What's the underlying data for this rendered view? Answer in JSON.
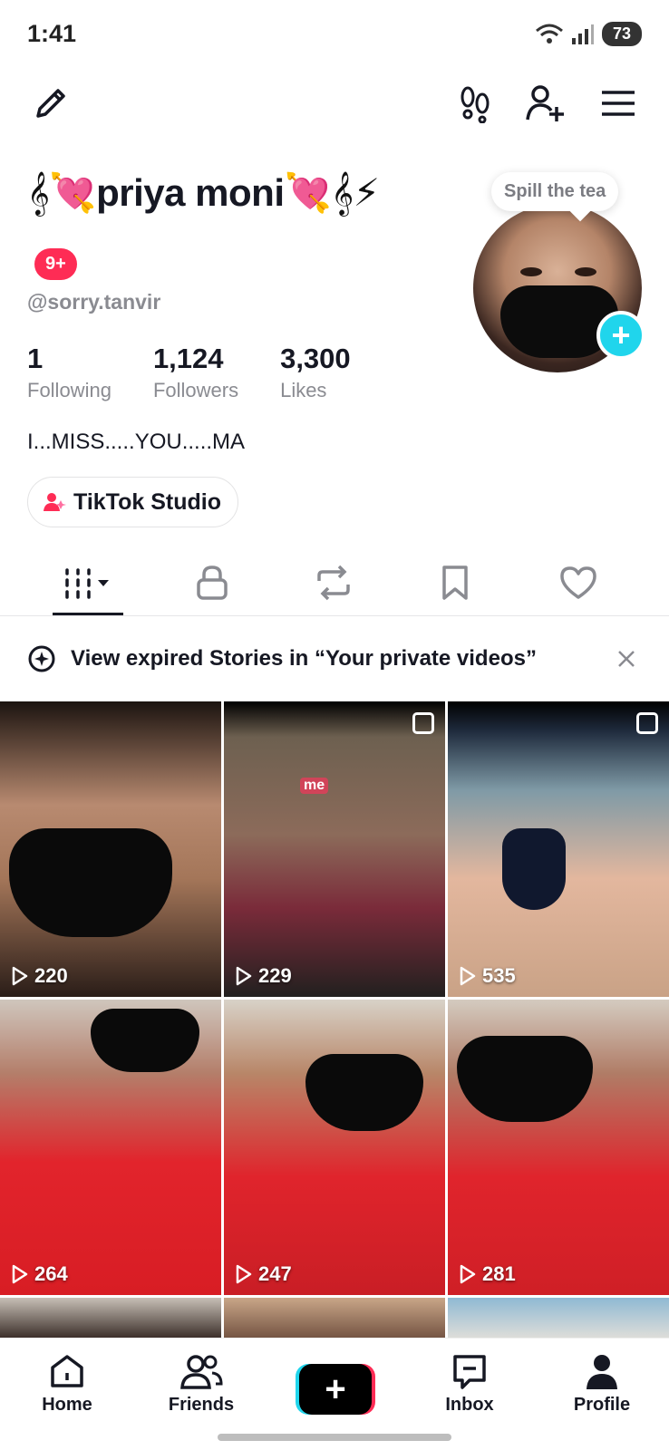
{
  "status_bar": {
    "time": "1:41",
    "battery": "73"
  },
  "profile": {
    "display_name_prefix": "𝄞💘",
    "display_name": "priya moni",
    "display_name_suffix": "💘𝄞⚡",
    "badge": "9+",
    "username": "@sorry.tanvir",
    "bubble_text": "Spill the tea",
    "avatar_plus": "+"
  },
  "stats": [
    {
      "value": "1",
      "label": "Following"
    },
    {
      "value": "1,124",
      "label": "Followers"
    },
    {
      "value": "3,300",
      "label": "Likes"
    }
  ],
  "bio": "I...MISS.....YOU.....MA",
  "studio_button": {
    "label": "TikTok Studio"
  },
  "tabs": [
    "videos",
    "private",
    "reposts",
    "favorites",
    "liked"
  ],
  "story_banner": {
    "text": "View expired Stories in “Your private videos”"
  },
  "videos": [
    {
      "views": "220"
    },
    {
      "views": "229",
      "overlay": "me"
    },
    {
      "views": "535"
    },
    {
      "views": "264"
    },
    {
      "views": "247"
    },
    {
      "views": "281"
    }
  ],
  "bottom_nav": {
    "home": "Home",
    "friends": "Friends",
    "create": "+",
    "inbox": "Inbox",
    "profile": "Profile"
  },
  "colors": {
    "accent": "#fe2c55",
    "cyan": "#20d5ec",
    "text": "#161823",
    "muted": "#8a8b91"
  }
}
